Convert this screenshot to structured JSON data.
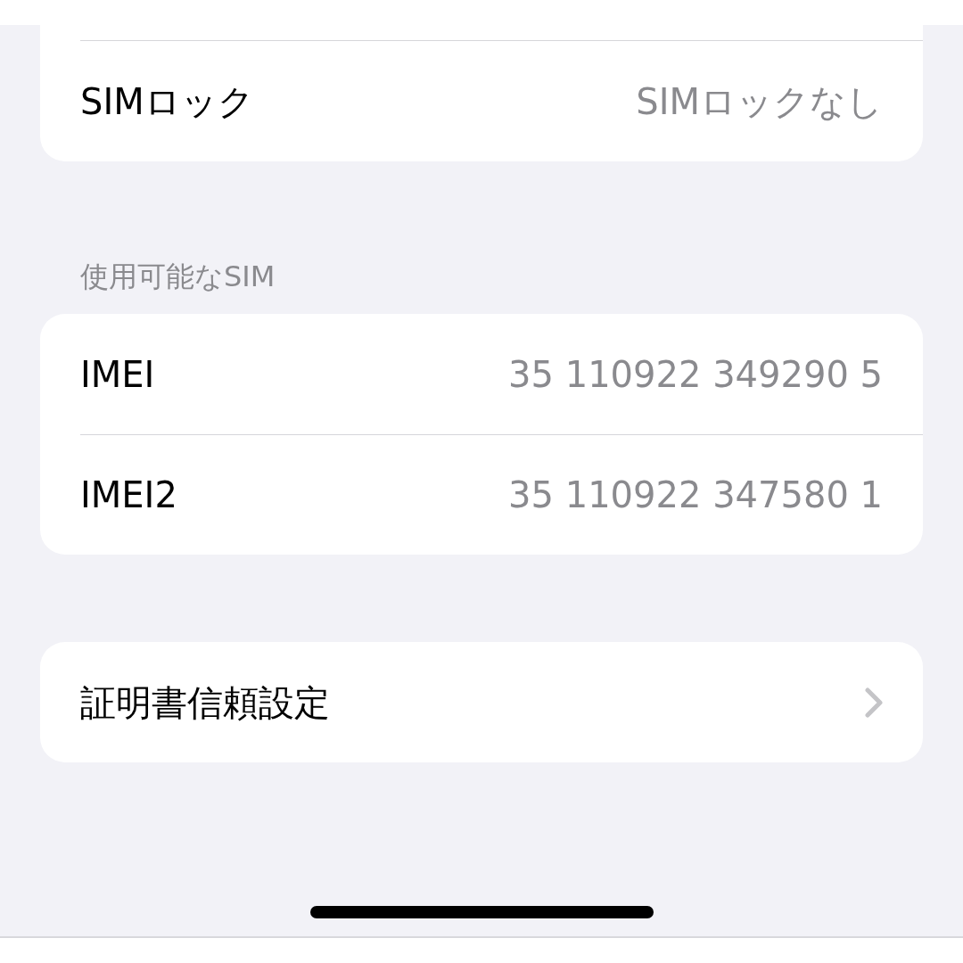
{
  "groups": [
    {
      "rows": [
        {
          "kind": "value",
          "label": "SIMロック",
          "value": "SIMロックなし"
        }
      ]
    },
    {
      "header": "使用可能なSIM",
      "rows": [
        {
          "kind": "value",
          "label": "IMEI",
          "value": "35 110922 349290 5"
        },
        {
          "kind": "value",
          "label": "IMEI2",
          "value": "35 110922 347580 1"
        }
      ]
    },
    {
      "rows": [
        {
          "kind": "link",
          "label": "証明書信頼設定"
        }
      ]
    }
  ]
}
